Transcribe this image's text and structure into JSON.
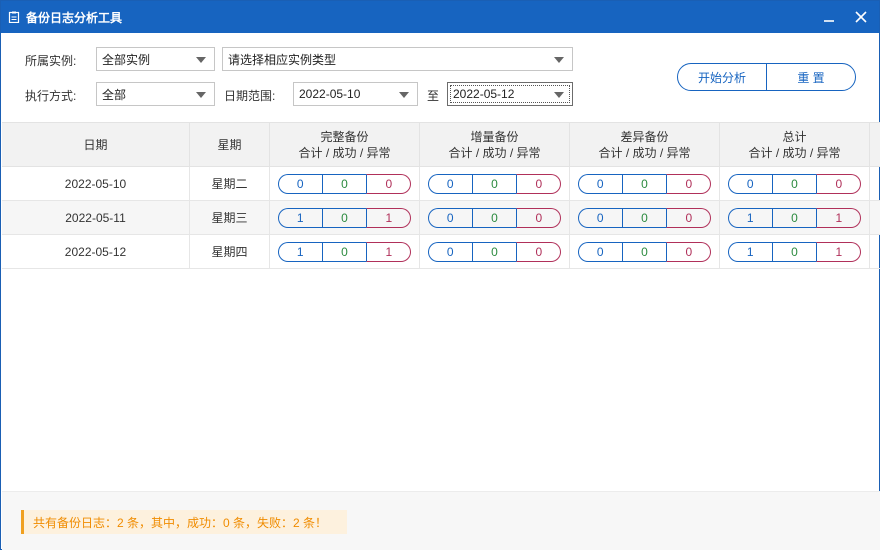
{
  "window": {
    "title": "备份日志分析工具"
  },
  "filters": {
    "instance_label": "所属实例:",
    "instance_value": "全部实例",
    "type_value": "请选择相应实例类型",
    "mode_label": "执行方式:",
    "mode_value": "全部",
    "date_label": "日期范围:",
    "date_from": "2022-05-10",
    "to_label": "至",
    "date_to": "2022-05-12"
  },
  "buttons": {
    "start": "开始分析",
    "reset": "重 置"
  },
  "table": {
    "headers": {
      "date": "日期",
      "weekday": "星期",
      "full": "完整备份",
      "incremental": "增量备份",
      "differential": "差异备份",
      "total": "总计",
      "sub": "合计 / 成功 / 异常"
    },
    "rows": [
      {
        "date": "2022-05-10",
        "weekday": "星期二",
        "full": [
          "0",
          "0",
          "0"
        ],
        "incremental": [
          "0",
          "0",
          "0"
        ],
        "differential": [
          "0",
          "0",
          "0"
        ],
        "total": [
          "0",
          "0",
          "0"
        ]
      },
      {
        "date": "2022-05-11",
        "weekday": "星期三",
        "full": [
          "1",
          "0",
          "1"
        ],
        "incremental": [
          "0",
          "0",
          "0"
        ],
        "differential": [
          "0",
          "0",
          "0"
        ],
        "total": [
          "1",
          "0",
          "1"
        ]
      },
      {
        "date": "2022-05-12",
        "weekday": "星期四",
        "full": [
          "1",
          "0",
          "1"
        ],
        "incremental": [
          "0",
          "0",
          "0"
        ],
        "differential": [
          "0",
          "0",
          "0"
        ],
        "total": [
          "1",
          "0",
          "1"
        ]
      }
    ]
  },
  "status": {
    "text": "共有备份日志：2 条，其中，成功：0 条，失败：2 条！"
  },
  "colors": {
    "accent": "#1764c0",
    "success": "#2b8a3e",
    "error": "#b0305a",
    "warning": "#f08c00"
  }
}
